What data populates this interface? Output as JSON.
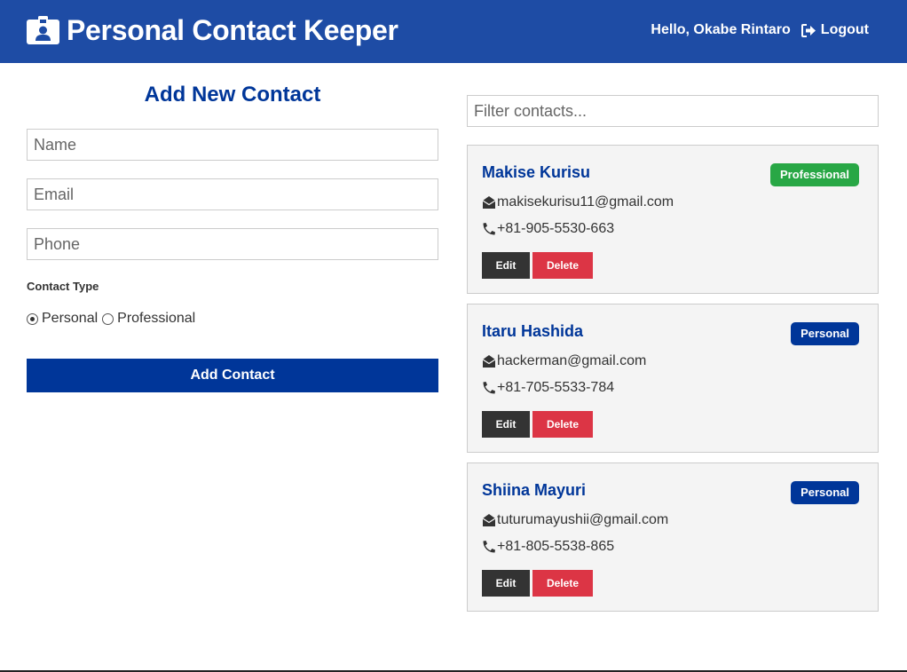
{
  "navbar": {
    "title": "Personal Contact Keeper",
    "greeting": "Hello, Okabe Rintaro",
    "logout_label": "Logout",
    "brand_icon": "id-badge-icon",
    "logout_icon": "sign-out-icon"
  },
  "form": {
    "title": "Add New Contact",
    "name_placeholder": "Name",
    "email_placeholder": "Email",
    "phone_placeholder": "Phone",
    "type_label": "Contact Type",
    "options": [
      {
        "label": "Personal",
        "checked": true
      },
      {
        "label": "Professional",
        "checked": false
      }
    ],
    "submit_label": "Add Contact"
  },
  "filter": {
    "placeholder": "Filter contacts..."
  },
  "contacts": [
    {
      "name": "Makise Kurisu",
      "type": "Professional",
      "email": "makisekurisu11@gmail.com",
      "phone": "+81-905-5530-663"
    },
    {
      "name": "Itaru Hashida",
      "type": "Personal",
      "email": "hackerman@gmail.com",
      "phone": "+81-705-5533-784"
    },
    {
      "name": "Shiina Mayuri",
      "type": "Personal",
      "email": "tuturumayushii@gmail.com",
      "phone": "+81-805-5538-865"
    }
  ],
  "card_buttons": {
    "edit_label": "Edit",
    "delete_label": "Delete"
  },
  "colors": {
    "primary": "#003699",
    "navbar": "#1e4ca5",
    "professional_badge": "#28a745",
    "personal_badge": "#003699",
    "danger": "#dc3545",
    "dark": "#333333"
  }
}
